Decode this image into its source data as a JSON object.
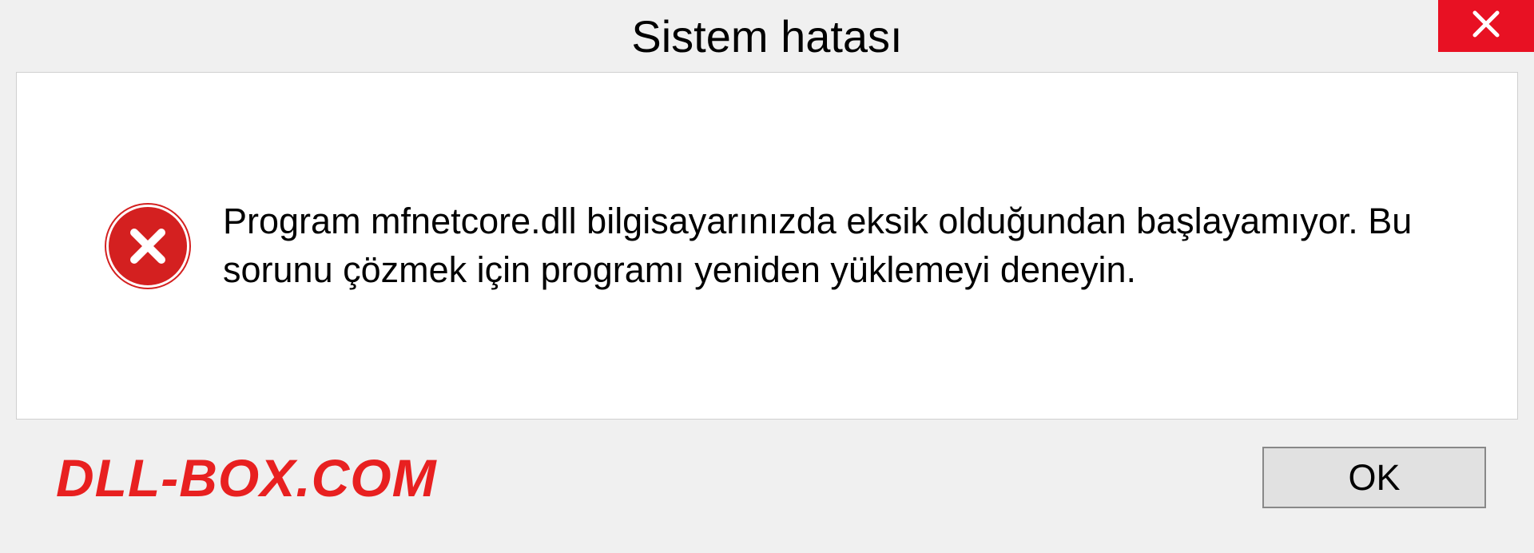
{
  "dialog": {
    "title": "Sistem hatası",
    "message": "Program mfnetcore.dll bilgisayarınızda eksik olduğundan başlayamıyor. Bu sorunu çözmek için programı yeniden yüklemeyi deneyin.",
    "ok_label": "OK"
  },
  "watermark": "DLL-BOX.COM"
}
